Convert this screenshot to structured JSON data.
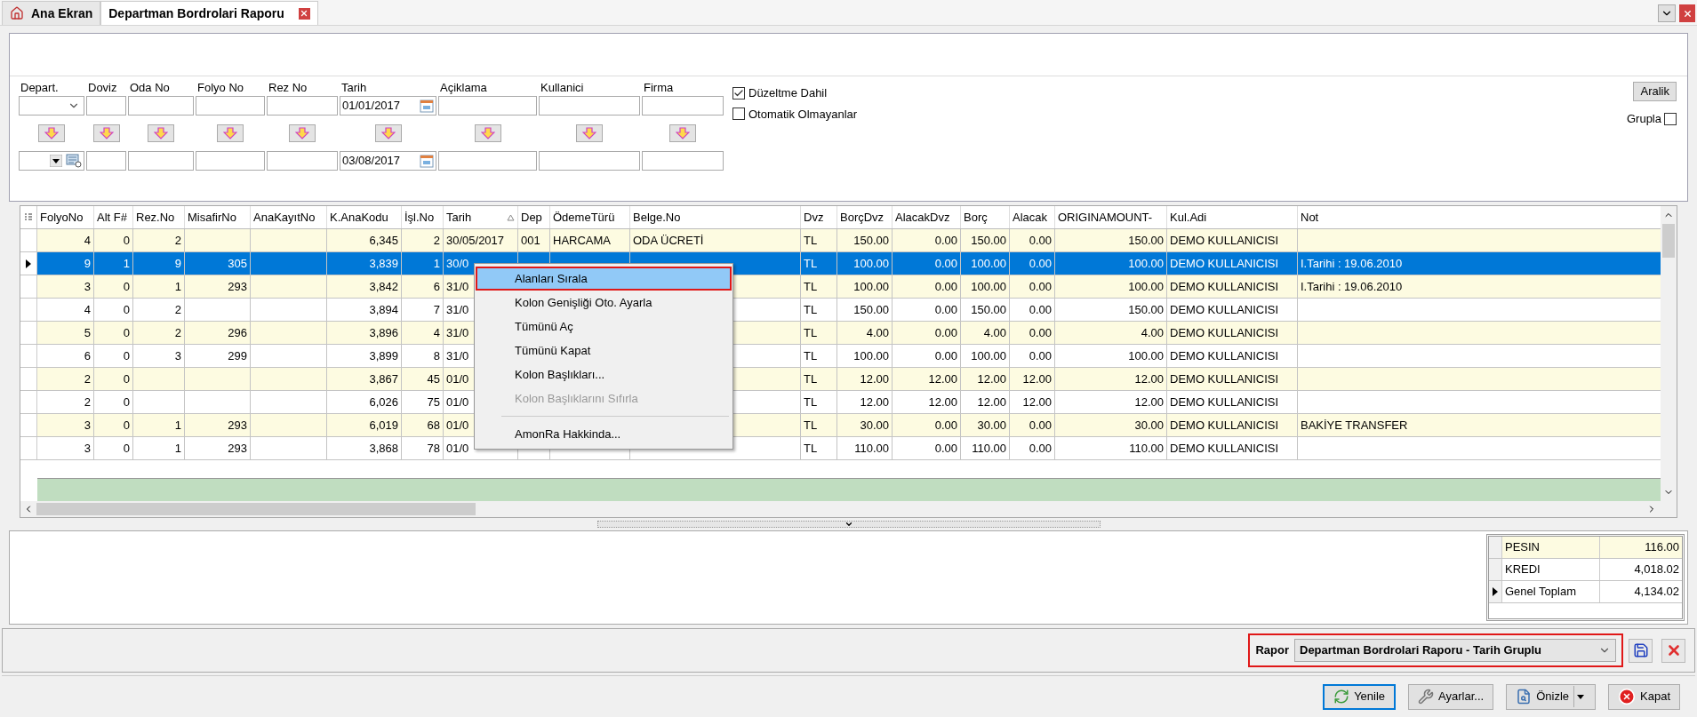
{
  "tabs": [
    {
      "label": "Ana Ekran",
      "kind": "home",
      "selected": false
    },
    {
      "label": "Departman Bordrolari Raporu",
      "kind": "report",
      "selected": true
    }
  ],
  "filters": [
    {
      "label": "Depart.",
      "kind": "select"
    },
    {
      "label": "Doviz",
      "kind": "text"
    },
    {
      "label": "Oda No",
      "kind": "text"
    },
    {
      "label": "Folyo No",
      "kind": "text"
    },
    {
      "label": "Rez No",
      "kind": "text"
    },
    {
      "label": "Tarih",
      "kind": "date",
      "from": "01/01/2017",
      "to": "03/08/2017"
    },
    {
      "label": "Açiklama",
      "kind": "text"
    },
    {
      "label": "Kullanici",
      "kind": "text"
    },
    {
      "label": "Firma",
      "kind": "text"
    }
  ],
  "options": [
    {
      "label": "Düzeltme Dahil",
      "checked": true
    },
    {
      "label": "Otomatik Olmayanlar",
      "checked": false
    }
  ],
  "range_button": "Aralik",
  "group": {
    "label": "Grupla",
    "checked": false
  },
  "grid": {
    "columns": [
      {
        "label": "FolyoNo",
        "kind": "number",
        "sorted": false
      },
      {
        "label": "Alt F#",
        "kind": "number",
        "sorted": false
      },
      {
        "label": "Rez.No",
        "kind": "number",
        "sorted": false
      },
      {
        "label": "MisafirNo",
        "kind": "number",
        "sorted": false
      },
      {
        "label": "AnaKayıtNo",
        "kind": "number",
        "sorted": false
      },
      {
        "label": "K.AnaKodu",
        "kind": "number",
        "sorted": false
      },
      {
        "label": "İşl.No",
        "kind": "number",
        "sorted": false
      },
      {
        "label": "Tarih",
        "kind": "text",
        "sorted": true
      },
      {
        "label": "Dep",
        "kind": "text",
        "sorted": false
      },
      {
        "label": "ÖdemeTürü",
        "kind": "text",
        "sorted": false
      },
      {
        "label": "Belge.No",
        "kind": "text",
        "sorted": false
      },
      {
        "label": "Dvz",
        "kind": "text",
        "sorted": false
      },
      {
        "label": "BorçDvz",
        "kind": "number",
        "sorted": false
      },
      {
        "label": "AlacakDvz",
        "kind": "number",
        "sorted": false
      },
      {
        "label": "Borç",
        "kind": "number",
        "sorted": false
      },
      {
        "label": "Alacak",
        "kind": "number",
        "sorted": false
      },
      {
        "label": "ORIGINAMOUNT-",
        "kind": "number",
        "sorted": false
      },
      {
        "label": "Kul.Adi",
        "kind": "text",
        "sorted": false
      },
      {
        "label": "Not",
        "kind": "text",
        "sorted": false
      }
    ],
    "rows": [
      {
        "selected": false,
        "cells": [
          "4",
          "0",
          "2",
          null,
          null,
          "6,345",
          "2",
          "30/05/2017",
          "001",
          "HARCAMA",
          "ODA ÜCRETİ",
          "TL",
          "150.00",
          "0.00",
          "150.00",
          "0.00",
          "150.00",
          "DEMO KULLANICISI",
          null
        ]
      },
      {
        "selected": true,
        "cells": [
          "9",
          "1",
          "9",
          "305",
          null,
          "3,839",
          "1",
          "30/0",
          null,
          null,
          null,
          "TL",
          "100.00",
          "0.00",
          "100.00",
          "0.00",
          "100.00",
          "DEMO KULLANICISI",
          "I.Tarihi : 19.06.2010"
        ]
      },
      {
        "selected": false,
        "cells": [
          "3",
          "0",
          "1",
          "293",
          null,
          "3,842",
          "6",
          "31/0",
          null,
          null,
          null,
          "TL",
          "100.00",
          "0.00",
          "100.00",
          "0.00",
          "100.00",
          "DEMO KULLANICISI",
          "I.Tarihi : 19.06.2010"
        ]
      },
      {
        "selected": false,
        "cells": [
          "4",
          "0",
          "2",
          null,
          null,
          "3,894",
          "7",
          "31/0",
          null,
          null,
          null,
          "TL",
          "150.00",
          "0.00",
          "150.00",
          "0.00",
          "150.00",
          "DEMO KULLANICISI",
          null
        ]
      },
      {
        "selected": false,
        "cells": [
          "5",
          "0",
          "2",
          "296",
          null,
          "3,896",
          "4",
          "31/0",
          null,
          null,
          null,
          "TL",
          "4.00",
          "0.00",
          "4.00",
          "0.00",
          "4.00",
          "DEMO KULLANICISI",
          null
        ]
      },
      {
        "selected": false,
        "cells": [
          "6",
          "0",
          "3",
          "299",
          null,
          "3,899",
          "8",
          "31/0",
          null,
          null,
          null,
          "TL",
          "100.00",
          "0.00",
          "100.00",
          "0.00",
          "100.00",
          "DEMO KULLANICISI",
          null
        ]
      },
      {
        "selected": false,
        "cells": [
          "2",
          "0",
          null,
          null,
          null,
          "3,867",
          "45",
          "01/0",
          null,
          null,
          null,
          "TL",
          "12.00",
          "12.00",
          "12.00",
          "12.00",
          "12.00",
          "DEMO KULLANICISI",
          null
        ]
      },
      {
        "selected": false,
        "cells": [
          "2",
          "0",
          null,
          null,
          null,
          "6,026",
          "75",
          "01/0",
          null,
          null,
          null,
          "TL",
          "12.00",
          "12.00",
          "12.00",
          "12.00",
          "12.00",
          "DEMO KULLANICISI",
          null
        ]
      },
      {
        "selected": false,
        "cells": [
          "3",
          "0",
          "1",
          "293",
          null,
          "6,019",
          "68",
          "01/0",
          null,
          null,
          null,
          "TL",
          "30.00",
          "0.00",
          "30.00",
          "0.00",
          "30.00",
          "DEMO KULLANICISI",
          "BAKİYE TRANSFER"
        ]
      },
      {
        "selected": false,
        "cells": [
          "3",
          "0",
          "1",
          "293",
          null,
          "3,868",
          "78",
          "01/0",
          null,
          null,
          null,
          "TL",
          "110.00",
          "0.00",
          "110.00",
          "0.00",
          "110.00",
          "DEMO KULLANICISI",
          null
        ]
      }
    ]
  },
  "context_menu": [
    {
      "kind": "item",
      "label": "Alanları Sırala",
      "selected": true,
      "disabled": false,
      "outlined": true
    },
    {
      "kind": "item",
      "label": "Kolon Genişliği Oto. Ayarla",
      "selected": false,
      "disabled": false,
      "outlined": false
    },
    {
      "kind": "item",
      "label": "Tümünü Aç",
      "selected": false,
      "disabled": false,
      "outlined": false
    },
    {
      "kind": "item",
      "label": "Tümünü Kapat",
      "selected": false,
      "disabled": false,
      "outlined": false
    },
    {
      "kind": "item",
      "label": "Kolon Başlıkları...",
      "selected": false,
      "disabled": false,
      "outlined": false
    },
    {
      "kind": "item",
      "label": "Kolon Başlıklarını Sıfırla",
      "selected": false,
      "disabled": true,
      "outlined": false
    },
    {
      "kind": "separator"
    },
    {
      "kind": "item",
      "label": "AmonRa Hakkinda...",
      "selected": false,
      "disabled": false,
      "outlined": false
    }
  ],
  "summary": [
    {
      "label": "PESIN",
      "value": "116.00",
      "selected": false
    },
    {
      "label": "KREDI",
      "value": "4,018.02",
      "selected": false
    },
    {
      "label": "Genel Toplam",
      "value": "4,134.02",
      "selected": true
    }
  ],
  "report": {
    "label": "Rapor",
    "value": "Departman Bordrolari Raporu - Tarih Gruplu",
    "outlined": true
  },
  "buttons": [
    {
      "label": "Yenile",
      "kind": "refresh",
      "focused": true
    },
    {
      "label": "Ayarlar...",
      "kind": "settings",
      "focused": false
    },
    {
      "label": "Önizle",
      "kind": "preview",
      "focused": false
    },
    {
      "label": "Kapat",
      "kind": "close",
      "focused": false
    }
  ]
}
